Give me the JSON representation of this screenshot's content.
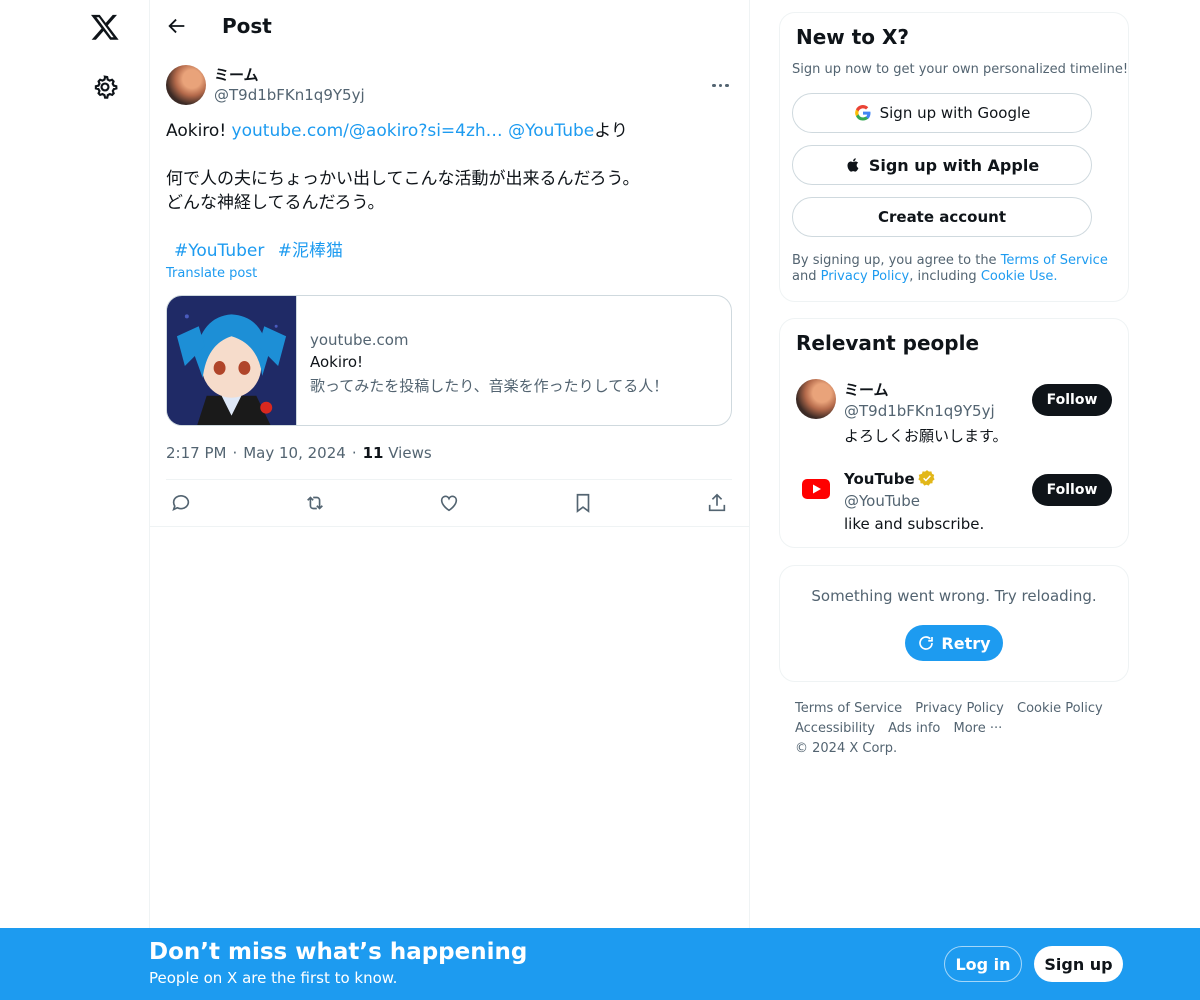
{
  "header": {
    "title": "Post"
  },
  "post": {
    "author_name": "ミーム",
    "author_handle": "@T9d1bFKn1q9Y5yj",
    "line1_prefix": "Aokiro! ",
    "line1_link": "youtube.com/@aokiro?si=4zh…",
    "line1_mention": "@YouTube",
    "line1_suffix": "より",
    "line2": "何で人の夫にちょっかい出してこんな活動が出来るんだろう。",
    "line3": "どんな神経してるんだろう。",
    "hashtags": [
      "#YouTuber",
      "#泥棒猫"
    ],
    "translate": "Translate post",
    "card": {
      "domain": "youtube.com",
      "title": "Aokiro!",
      "description": "歌ってみたを投稿したり、音楽を作ったりしてる人！"
    },
    "time": "2:17 PM",
    "date": "May 10, 2024",
    "views_count": "11",
    "views_label": "Views"
  },
  "signup_box": {
    "title": "New to X?",
    "subtitle": "Sign up now to get your own personalized timeline!",
    "google": "Sign up with Google",
    "apple": "Sign up with Apple",
    "create": "Create account",
    "legal_1": "By signing up, you agree to the ",
    "terms": "Terms of Service",
    "legal_2": " and ",
    "privacy": "Privacy Policy",
    "legal_3": ", including ",
    "cookie": "Cookie Use."
  },
  "relevant": {
    "title": "Relevant people",
    "people": [
      {
        "name": "ミーム",
        "handle": "@T9d1bFKn1q9Y5yj",
        "bio": "よろしくお願いします。",
        "follow": "Follow"
      },
      {
        "name": "YouTube",
        "handle": "@YouTube",
        "bio": "like and subscribe.",
        "follow": "Follow"
      }
    ]
  },
  "error_box": {
    "message": "Something went wrong. Try reloading.",
    "retry": "Retry"
  },
  "footer": {
    "links": [
      "Terms of Service",
      "Privacy Policy",
      "Cookie Policy",
      "Accessibility",
      "Ads info",
      "More ···",
      "© 2024 X Corp."
    ]
  },
  "banner": {
    "title": "Don’t miss what’s happening",
    "subtitle": "People on X are the first to know.",
    "login": "Log in",
    "signup": "Sign up"
  },
  "colors": {
    "accent": "#1d9bf0",
    "text": "#0f1419",
    "muted": "#536471",
    "border": "#eff3f4"
  },
  "icons": [
    "x-logo-icon",
    "gear-icon",
    "back-arrow-icon",
    "more-icon",
    "reply-icon",
    "repost-icon",
    "like-icon",
    "bookmark-icon",
    "share-icon",
    "google-icon",
    "apple-icon",
    "verified-icon",
    "youtube-icon",
    "refresh-icon"
  ]
}
